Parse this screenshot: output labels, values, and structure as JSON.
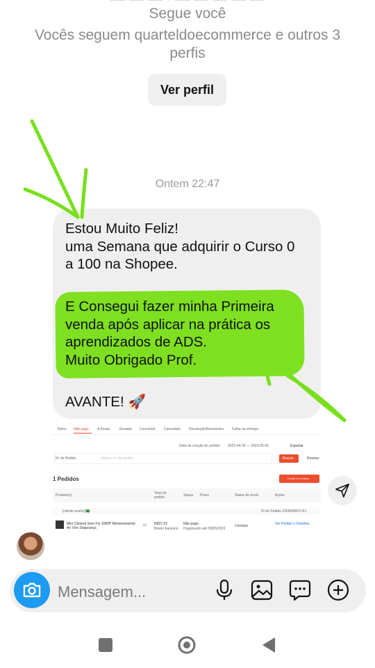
{
  "profile_header": {
    "clipped_line": "— — — · — — — — —",
    "follows_you": "Segue você",
    "mutual_followers": "Vocês seguem quarteldoecommerce e outros 3\nperfis",
    "view_profile_label": "Ver perfil"
  },
  "chat": {
    "timestamp": "Ontem 22:47",
    "message_part1": "Estou Muito Feliz!\numa Semana que adquirir o Curso 0\na 100 na Shopee.",
    "message_part2": "E Consegui fazer minha Primeira\nvenda após aplicar na prática os\naprendizados de ADS.\nMuito Obrigado Prof.",
    "message_part3": "AVANTE!",
    "message_emoji": "🚀",
    "highlight_color": "#7ee020"
  },
  "attachment": {
    "tabs": [
      "Todos",
      "Não pago",
      "A Enviar",
      "Enviado",
      "Concluído",
      "Cancelado",
      "Devolução/Reembolso",
      "Falha na entrega"
    ],
    "date_label": "Data de criação do pedido",
    "date_range": "2023-04-30 — 2023-05-06",
    "export_label": "Exportar",
    "search_field": "Nº do Pedido",
    "search_placeholder": "Insira o nº do pedido",
    "search_button": "Buscar",
    "reset_label": "Resetar",
    "orders_title": "1 Pedidos",
    "bulk_button": "Enviar em massa",
    "columns": [
      "Produto(s)",
      "Total do pedido",
      "Status",
      "Prazo",
      "Status do envio",
      "Ações"
    ],
    "order_user": "[cliente oculto] 🇧🇷",
    "order_id": "ID do Pedido 230506BR7LKJ",
    "product_name": "Mini Câmera Sem Fio 1080P Monitoramento Ao Vivo Segurança",
    "quantity": "x1",
    "order_total": "R$37,53",
    "payment": "Boleto bancário",
    "status": "Não pago",
    "deadline": "Pagamento até 08/05/2023",
    "shipping": "Correios",
    "action": "Ver Pedido e Detalhes"
  },
  "composer": {
    "placeholder": "Mensagem..."
  },
  "icons": {
    "camera": "camera-icon",
    "mic": "microphone-icon",
    "gallery": "gallery-icon",
    "sticker": "sticker-chat-icon",
    "add": "plus-circle-icon",
    "share": "send-icon"
  },
  "colors": {
    "accent_blue": "#1d9bf0",
    "bubble_bg": "#efefef",
    "shopee_orange": "#ee4d2d",
    "annotation_green": "#7ee020"
  }
}
